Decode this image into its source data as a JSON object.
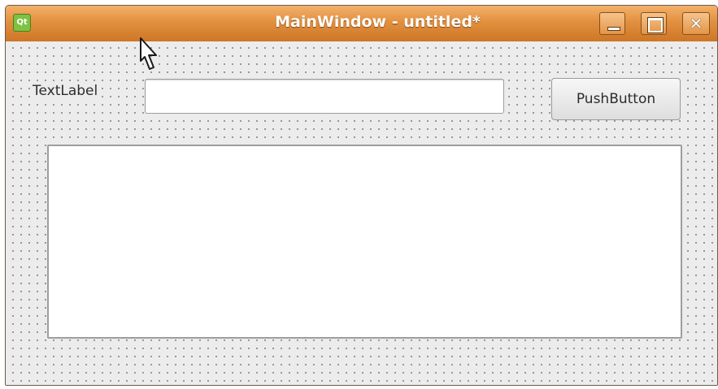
{
  "window": {
    "title": "MainWindow - untitled*",
    "logo_text": "Qt",
    "controls": [
      "minimize-icon",
      "maximize-icon",
      "close-icon"
    ],
    "close_glyph": "✕"
  },
  "form": {
    "label_text": "TextLabel",
    "line_edit_value": "",
    "push_button_label": "PushButton",
    "text_edit_value": ""
  },
  "colors": {
    "titlebar_accent": "#e2903f",
    "form_background": "#ececec"
  }
}
